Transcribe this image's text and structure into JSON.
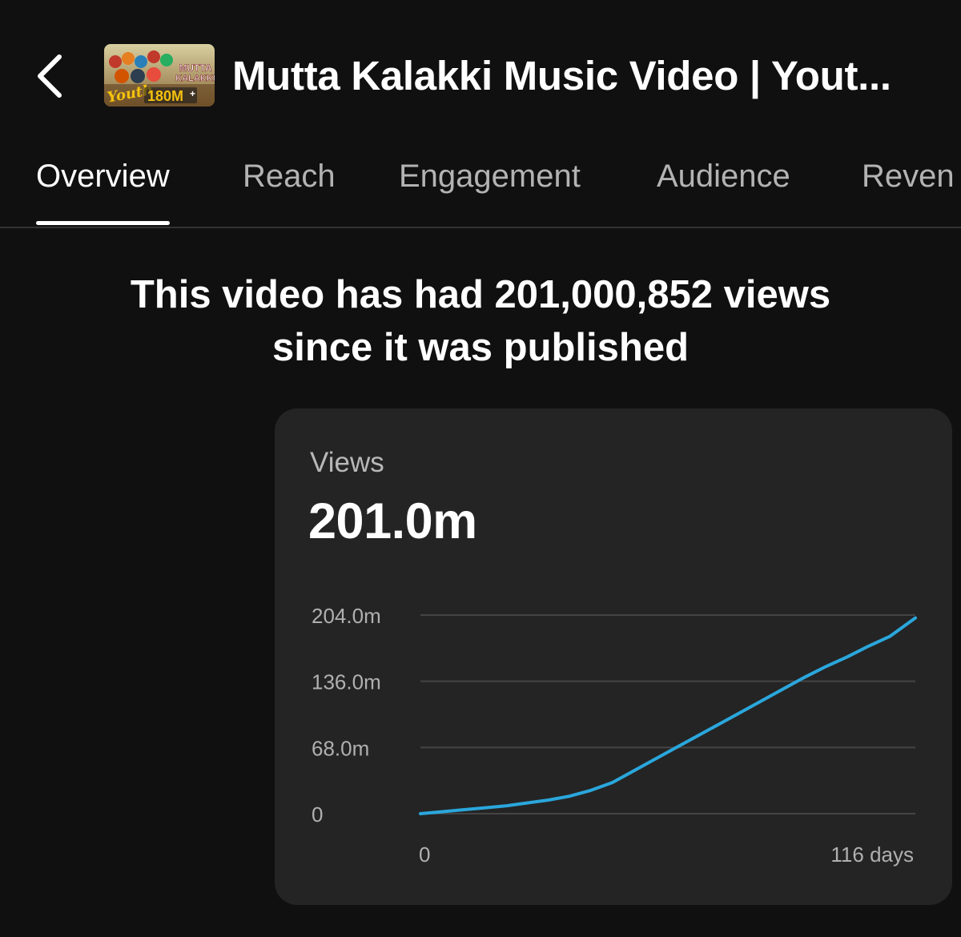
{
  "header": {
    "back_icon": "chevron-left-icon",
    "thumbnail": {
      "text_line1": "MUTTA",
      "text_line2": "KALAKKI",
      "script_text": "Youth",
      "badge_text": "180M",
      "badge_suffix": "+"
    },
    "title": "Mutta Kalakki Music Video | Yout..."
  },
  "tabs": [
    {
      "label": "Overview",
      "active": true
    },
    {
      "label": "Reach",
      "active": false
    },
    {
      "label": "Engagement",
      "active": false
    },
    {
      "label": "Audience",
      "active": false
    },
    {
      "label": "Reven",
      "active": false
    }
  ],
  "headline": {
    "line1": "This video has had 201,000,852 views",
    "line2": "since it was published"
  },
  "card": {
    "label": "Views",
    "value": "201.0m"
  },
  "chart_data": {
    "type": "line",
    "y_tick_labels": [
      "0",
      "68.0m",
      "136.0m",
      "204.0m"
    ],
    "x_tick_labels": [
      "0",
      "116 days"
    ],
    "ylim": [
      0,
      204
    ],
    "xlim": [
      0,
      116
    ],
    "grid": true,
    "line_color": "#2aa7dc",
    "series": [
      {
        "x": [
          0,
          5,
          10,
          15,
          20,
          25,
          30,
          35,
          40,
          45,
          50,
          55,
          60,
          65,
          70,
          75,
          80,
          85,
          90,
          95,
          100,
          105,
          110,
          116
        ],
        "values": [
          0,
          2,
          4,
          6,
          8,
          11,
          14,
          18,
          24,
          32,
          44,
          56,
          68,
          80,
          92,
          104,
          116,
          128,
          140,
          151,
          161,
          172,
          182,
          201
        ]
      }
    ]
  }
}
